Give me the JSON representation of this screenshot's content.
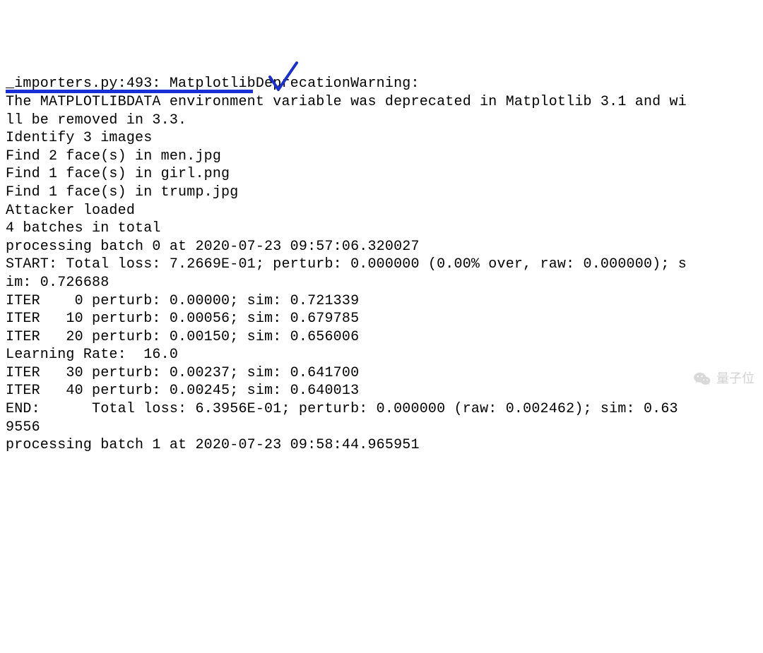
{
  "lines": [
    "_importers.py:493: MatplotlibDeprecationWarning:",
    "The MATPLOTLIBDATA environment variable was deprecated in Matplotlib 3.1 and wi",
    "ll be removed in 3.3.",
    "Identify 3 images",
    "Find 2 face(s) in men.jpg",
    "Find 1 face(s) in girl.png",
    "Find 1 face(s) in trump.jpg",
    "Attacker loaded",
    "4 batches in total",
    "processing batch 0 at 2020-07-23 09:57:06.320027",
    "START: Total loss: 7.2669E-01; perturb: 0.000000 (0.00% over, raw: 0.000000); s",
    "im: 0.726688",
    "ITER    0 perturb: 0.00000; sim: 0.721339",
    "ITER   10 perturb: 0.00056; sim: 0.679785",
    "ITER   20 perturb: 0.00150; sim: 0.656006",
    "Learning Rate:  16.0",
    "ITER   30 perturb: 0.00237; sim: 0.641700",
    "ITER   40 perturb: 0.00245; sim: 0.640013",
    "END:      Total loss: 6.3956E-01; perturb: 0.000000 (raw: 0.002462); sim: 0.63",
    "9556",
    "processing batch 1 at 2020-07-23 09:58:44.965951"
  ],
  "watermark": {
    "label": "量子位"
  }
}
